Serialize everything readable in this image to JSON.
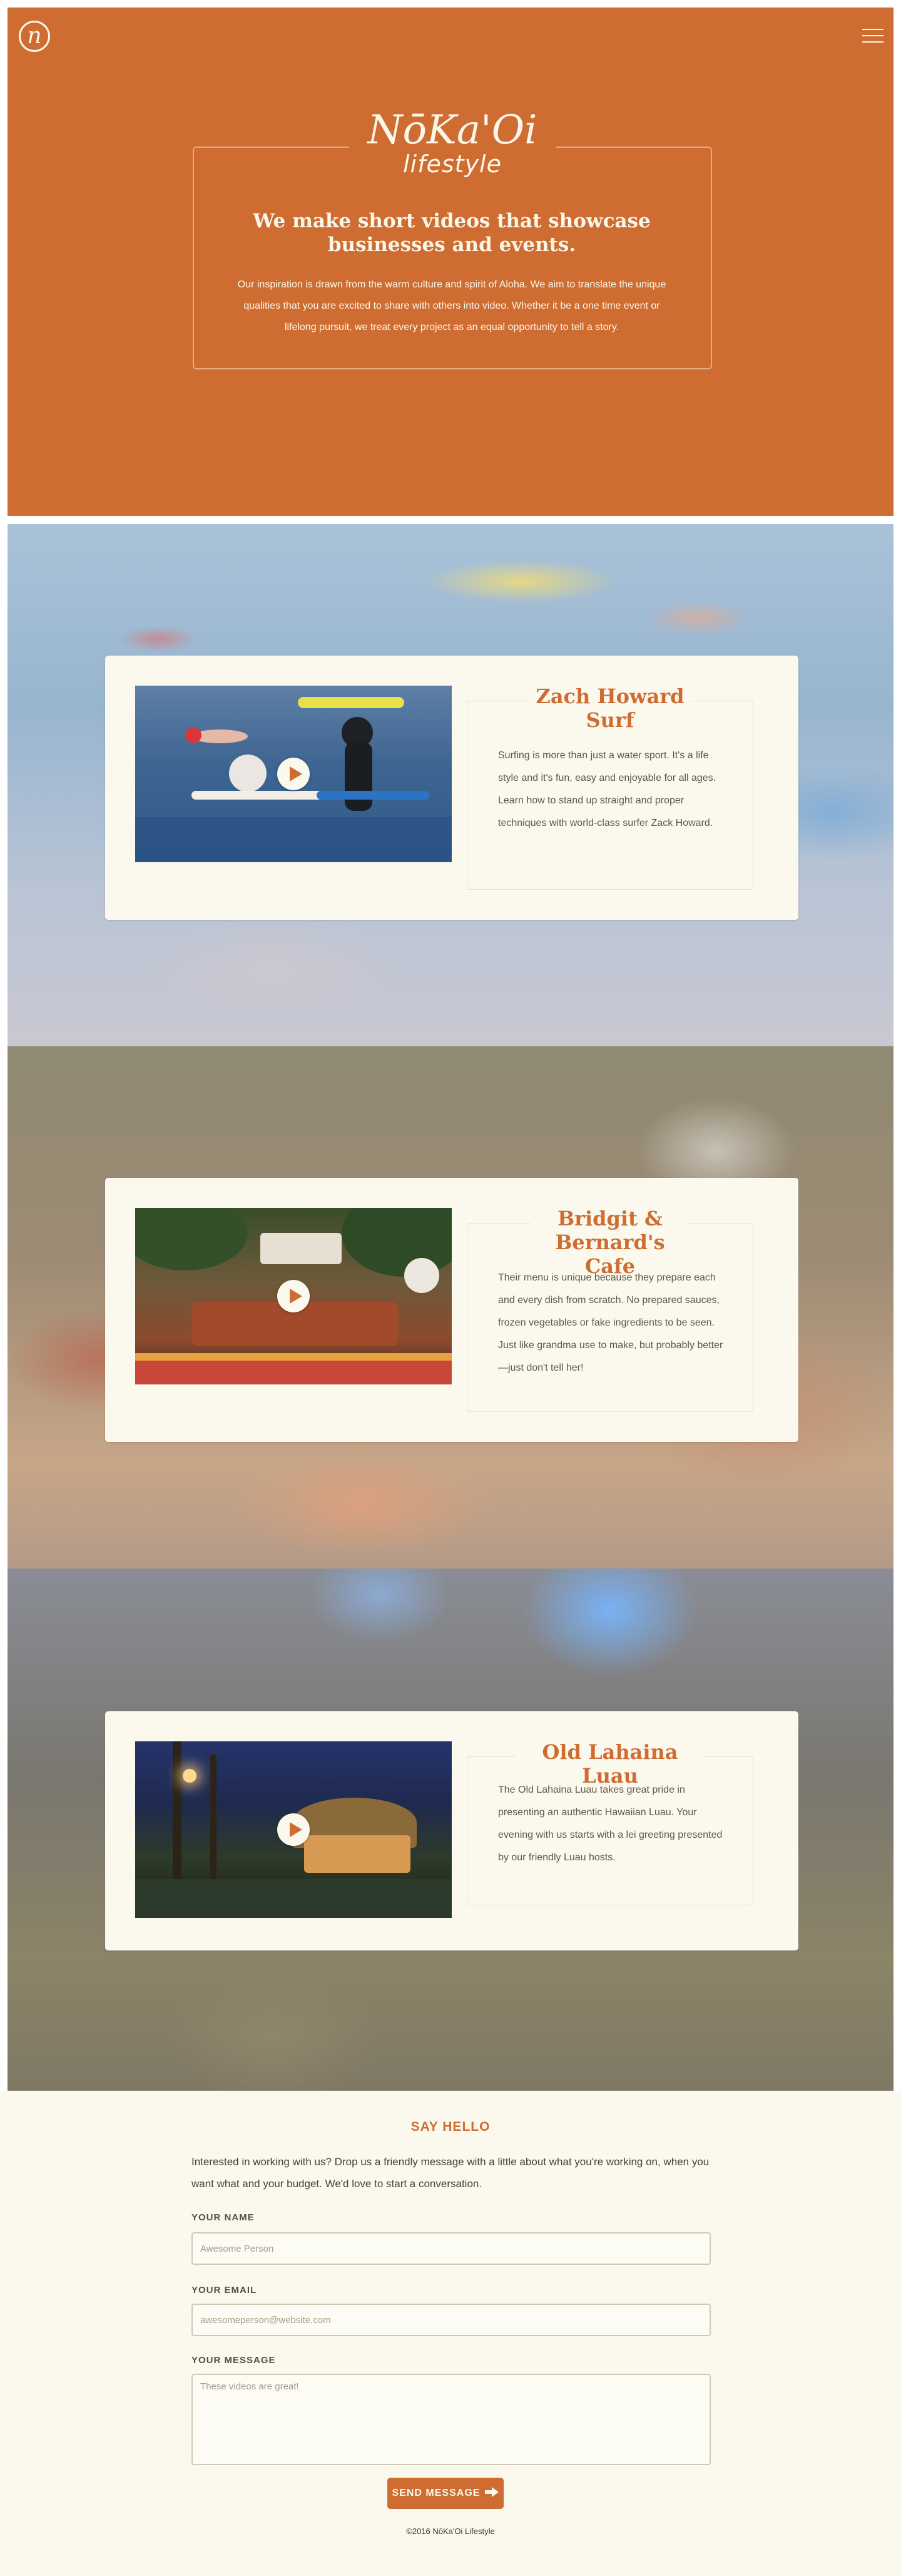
{
  "header": {
    "logo_letter": "n",
    "brand_name": "NōKa'Oi",
    "brand_tagline": "lifestyle",
    "intro_heading": "We make short videos that showcase businesses and events.",
    "intro_text": "Our inspiration is drawn from the warm culture and spirit of Aloha. We aim to translate the unique qualities that you are excited to share with others into video. Whether it be a one time event or lifelong pursuit, we treat every project as an equal opportunity to tell a story."
  },
  "videos": [
    {
      "title": "Zach Howard Surf",
      "description": "Surfing is more than just a water sport. It's a life style and it's fun, easy and enjoyable for all ages. Learn how to stand up straight and proper techniques with world-class surfer Zack Howard."
    },
    {
      "title": "Bridgit & Bernard's Cafe",
      "description": "Their menu is unique because they prepare each and every dish from scratch. No prepared sauces, frozen vegetables or fake ingredients to be seen. Just like grandma use to make, but probably better—just don't tell her!"
    },
    {
      "title": "Old Lahaina Luau",
      "description": "The Old Lahaina Luau takes great pride in presenting an authentic Hawaiian Luau. Your evening with us starts with a lei greeting presented by our friendly Luau hosts."
    }
  ],
  "contact": {
    "heading": "SAY HELLO",
    "intro": "Interested in working with us? Drop us a friendly message with a little about what you're working on, when you want what and your budget. We'd love to start a conversation.",
    "name_label": "YOUR NAME",
    "name_placeholder": "Awesome Person",
    "email_label": "YOUR EMAIL",
    "email_placeholder": "awesomeperson@website.com",
    "message_label": "YOUR MESSAGE",
    "message_placeholder": "These videos are great!",
    "send_label": "SEND MESSAGE"
  },
  "footer": {
    "copyright": "©2016 NōKa'Oi Lifestyle"
  },
  "colors": {
    "accent": "#cf6c31",
    "cream": "#fbf9ed"
  },
  "icons": {
    "menu": "hamburger-icon",
    "play": "play-icon",
    "send": "arrow-right-icon"
  }
}
